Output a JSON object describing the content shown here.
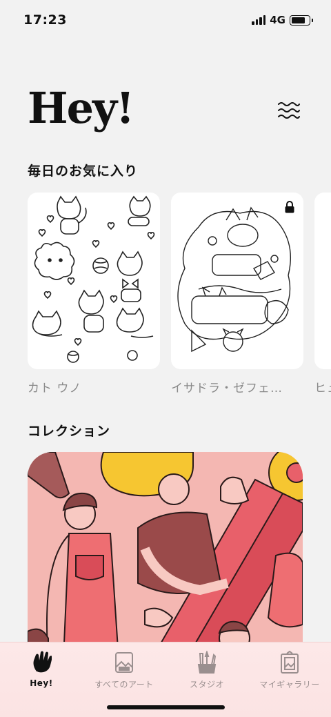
{
  "status": {
    "time": "17:23",
    "network": "4G",
    "battery_level": 0.8
  },
  "header": {
    "title": "Hey!",
    "menu_icon": "wave-menu-icon"
  },
  "favorites": {
    "title": "毎日のお気に入り",
    "items": [
      {
        "label": "カト ウノ",
        "locked": false
      },
      {
        "label": "イサドラ・ゼフェ…",
        "locked": true
      },
      {
        "label": "ヒュ",
        "locked": false
      }
    ]
  },
  "collections": {
    "title": "コレクション"
  },
  "tabbar": {
    "tabs": [
      {
        "label": "Hey!",
        "icon": "hand-wave-icon",
        "active": true
      },
      {
        "label": "すべてのアート",
        "icon": "gallery-icon",
        "active": false
      },
      {
        "label": "スタジオ",
        "icon": "brushes-icon",
        "active": false
      },
      {
        "label": "マイギャラリー",
        "icon": "frame-icon",
        "active": false
      }
    ]
  },
  "colors": {
    "background": "#f2f2f2",
    "tabbar": "#fbe3e3",
    "accent_pink": "#e8606a",
    "yellow": "#f6c631"
  }
}
